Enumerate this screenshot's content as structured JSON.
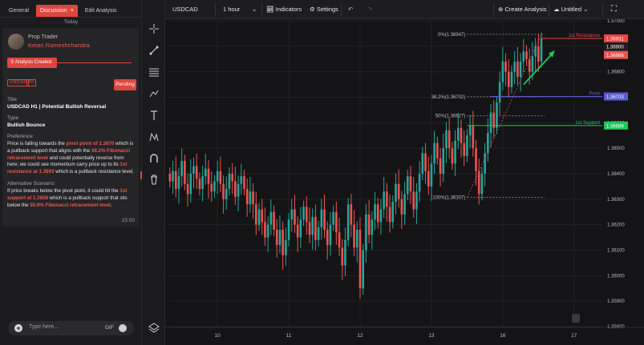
{
  "left_panel": {
    "tabs": [
      {
        "label": "General"
      },
      {
        "label": "Discussion",
        "close": "×"
      },
      {
        "label": "Edit Analysis"
      }
    ],
    "date_divider": "Today",
    "message": {
      "role": "Prop Trader",
      "user": "Ketan Rameshchandra",
      "status_label": "Analysis Created",
      "badges": [
        "USDCAD",
        "H1"
      ],
      "pending_label": "Pending",
      "title_label": "Title",
      "title_value": "USDCAD H1 | Potential Bullish Reversal",
      "type_label": "Type",
      "type_value": "Bullish Bounce",
      "preference_label": "Preference:",
      "preference_text": [
        {
          "t": "Price is falling towards the ",
          "h": false
        },
        {
          "t": "pivot point of 1.3670",
          "h": true
        },
        {
          "t": " which is a pullback support that aligns with the ",
          "h": false
        },
        {
          "t": "38.2% Fibonacci retracement level",
          "h": true
        },
        {
          "t": " and could potentially reverse from here; we could see momentum carry price up to its ",
          "h": false
        },
        {
          "t": "1st resistance at 1.3693",
          "h": true
        },
        {
          "t": " which is a pullback resistance level.",
          "h": false
        }
      ],
      "alt_label": "Alternative Scenario:",
      "alt_text": [
        {
          "t": "If price breaks below the pivot point, it could hit the ",
          "h": false
        },
        {
          "t": "1st support at 1.3658",
          "h": true
        },
        {
          "t": " which is a pullback support that sits below the ",
          "h": false
        },
        {
          "t": "50.0% Fibonacci retracement level",
          "h": true
        },
        {
          "t": ".",
          "h": false
        }
      ],
      "time": "15:50"
    },
    "composer": {
      "placeholder": "Type here...",
      "gif": "GIF"
    }
  },
  "toolbar": {
    "symbol": "USDCAD",
    "timeframe": "1 hour",
    "indicators": "Indicators",
    "settings": "Settings",
    "create": "Create Analysis",
    "layout_name": "Untitled"
  },
  "colors": {
    "up": "#26a69a",
    "down": "#ef5350",
    "accent": "#e0453d",
    "pivot": "#5b5bd6",
    "support": "#22c55e",
    "resistance": "#ef4444"
  },
  "chart_data": {
    "type": "candlestick",
    "symbol": "USDCAD",
    "timeframe": "1 hour",
    "ylim": [
      1.358,
      1.37
    ],
    "y_ticks": [
      1.37,
      1.369,
      1.368,
      1.367,
      1.366,
      1.365,
      1.364,
      1.363,
      1.362,
      1.361,
      1.36,
      1.359,
      1.358
    ],
    "x_ticks": [
      {
        "label": "10",
        "i": 16
      },
      {
        "label": "11",
        "i": 40
      },
      {
        "label": "12",
        "i": 64
      },
      {
        "label": "13",
        "i": 88
      },
      {
        "label": "16",
        "i": 112
      },
      {
        "label": "17",
        "i": 136
      }
    ],
    "n_slots": 146,
    "closes": [
      1.3637,
      1.3641,
      1.3634,
      1.3639,
      1.3645,
      1.3636,
      1.3632,
      1.364,
      1.3643,
      1.3638,
      1.3634,
      1.3639,
      1.3642,
      1.3636,
      1.3633,
      1.3637,
      1.3641,
      1.3636,
      1.363,
      1.3634,
      1.364,
      1.3637,
      1.3631,
      1.3636,
      1.3639,
      1.3634,
      1.3628,
      1.3633,
      1.3628,
      1.362,
      1.3626,
      1.3621,
      1.3615,
      1.362,
      1.3625,
      1.3618,
      1.3612,
      1.3618,
      1.3608,
      1.3614,
      1.3622,
      1.3626,
      1.362,
      1.3615,
      1.3622,
      1.3627,
      1.3621,
      1.3616,
      1.3623,
      1.3614,
      1.3619,
      1.3626,
      1.3618,
      1.3612,
      1.362,
      1.3625,
      1.3617,
      1.3611,
      1.3604,
      1.3614,
      1.3628,
      1.362,
      1.3611,
      1.3618,
      1.3595,
      1.361,
      1.3624,
      1.3616,
      1.3622,
      1.3628,
      1.3621,
      1.3626,
      1.3633,
      1.3627,
      1.3621,
      1.3629,
      1.3636,
      1.363,
      1.3624,
      1.3632,
      1.3639,
      1.3633,
      1.3626,
      1.3633,
      1.364,
      1.3648,
      1.3641,
      1.3635,
      1.3644,
      1.3652,
      1.3646,
      1.364,
      1.365,
      1.3657,
      1.365,
      1.3644,
      1.3653,
      1.3658,
      1.3652,
      1.3647,
      1.3655,
      1.3659,
      1.365,
      1.3641,
      1.3632,
      1.364,
      1.3648,
      1.3656,
      1.3664,
      1.3658,
      1.3668,
      1.3676,
      1.3684,
      1.368,
      1.3674,
      1.368,
      1.3684,
      1.3678,
      1.3684,
      1.3688,
      1.3685,
      1.368,
      1.3686,
      1.369,
      1.3684,
      1.3693
    ],
    "series_note": "",
    "levels": [
      {
        "name": "1st Resistance",
        "price": "1.36931",
        "value": 1.36931
      },
      {
        "name": "Pivot",
        "price": "1.36703",
        "value": 1.36703
      },
      {
        "name": "1st Support",
        "price": "1.36589",
        "value": 1.36589
      }
    ],
    "last_price": {
      "price": "1.36866",
      "value": 1.36866
    },
    "price_900": {
      "price": "1.36900",
      "value": 1.369
    },
    "fib": [
      {
        "label": "0%(1.36947)",
        "value": 1.36947
      },
      {
        "label": "38.2%(1.36702)",
        "value": 1.36702
      },
      {
        "label": "50%(1.36627)",
        "value": 1.36627
      },
      {
        "label": "100%(1.36307)",
        "value": 1.36307
      }
    ]
  }
}
